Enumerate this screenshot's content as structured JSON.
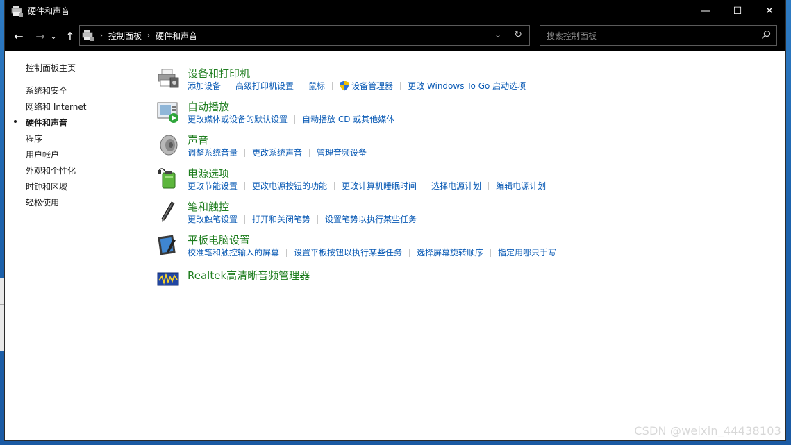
{
  "window": {
    "title": "硬件和声音",
    "controls": {
      "minimize": "—",
      "maximize": "☐",
      "close": "✕"
    }
  },
  "nav": {
    "back": "←",
    "forward": "→",
    "recent": "⌄",
    "up": "↑",
    "breadcrumb": [
      "控制面板",
      "硬件和声音"
    ],
    "dropdown": "⌄",
    "refresh": "↻"
  },
  "search": {
    "placeholder": "搜索控制面板"
  },
  "sidebar": {
    "home": "控制面板主页",
    "items": [
      {
        "label": "系统和安全",
        "active": false
      },
      {
        "label": "网络和 Internet",
        "active": false
      },
      {
        "label": "硬件和声音",
        "active": true
      },
      {
        "label": "程序",
        "active": false
      },
      {
        "label": "用户帐户",
        "active": false
      },
      {
        "label": "外观和个性化",
        "active": false
      },
      {
        "label": "时钟和区域",
        "active": false
      },
      {
        "label": "轻松使用",
        "active": false
      }
    ]
  },
  "sections": [
    {
      "title": "设备和打印机",
      "icon": "printer-icon",
      "links": [
        "添加设备",
        "高级打印机设置",
        "鼠标",
        "设备管理器",
        "更改 Windows To Go 启动选项"
      ]
    },
    {
      "title": "自动播放",
      "icon": "autoplay-icon",
      "links": [
        "更改媒体或设备的默认设置",
        "自动播放 CD 或其他媒体"
      ]
    },
    {
      "title": "声音",
      "icon": "speaker-icon",
      "links": [
        "调整系统音量",
        "更改系统声音",
        "管理音频设备"
      ]
    },
    {
      "title": "电源选项",
      "icon": "battery-icon",
      "links": [
        "更改节能设置",
        "更改电源按钮的功能",
        "更改计算机睡眠时间",
        "选择电源计划",
        "编辑电源计划"
      ]
    },
    {
      "title": "笔和触控",
      "icon": "pen-icon",
      "links": [
        "更改触笔设置",
        "打开和关闭笔势",
        "设置笔势以执行某些任务"
      ]
    },
    {
      "title": "平板电脑设置",
      "icon": "tablet-icon",
      "links": [
        "校准笔和触控输入的屏幕",
        "设置平板按钮以执行某些任务",
        "选择屏幕旋转顺序",
        "指定用哪只手写"
      ]
    },
    {
      "title": "Realtek高清晰音频管理器",
      "icon": "realtek-audio-icon",
      "links": []
    }
  ],
  "watermark": "CSDN @weixin_44438103",
  "colors": {
    "title_green": "#1e7d1e",
    "link_blue": "#0b5bb5"
  }
}
